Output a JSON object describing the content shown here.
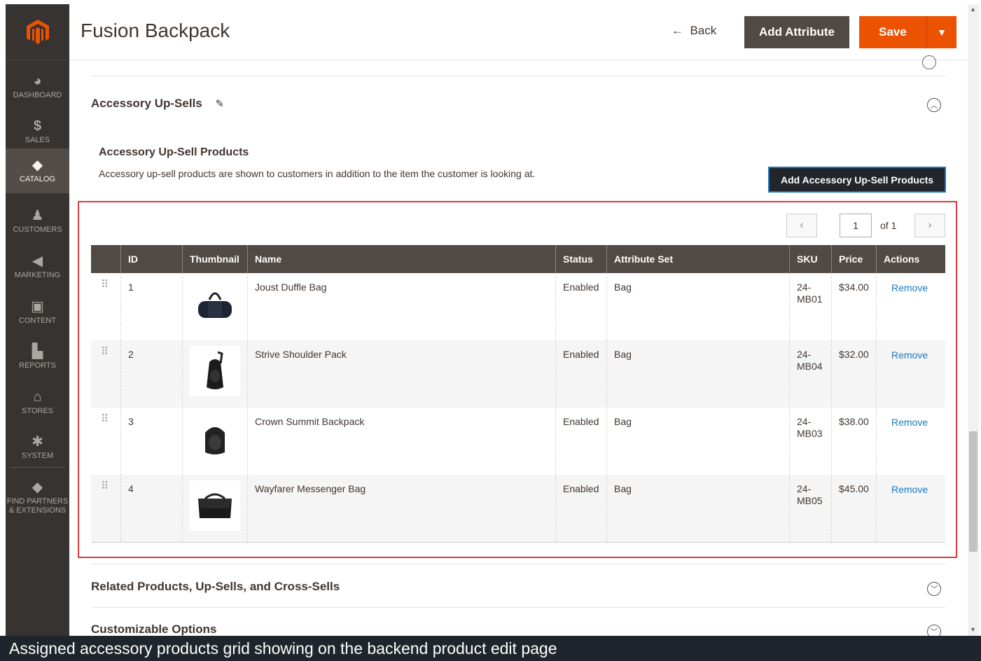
{
  "sidebar": {
    "items": [
      {
        "label": "DASHBOARD",
        "icon": "dashboard-icon"
      },
      {
        "label": "SALES",
        "icon": "dollar-icon"
      },
      {
        "label": "CATALOG",
        "icon": "cube-icon"
      },
      {
        "label": "CUSTOMERS",
        "icon": "person-icon"
      },
      {
        "label": "MARKETING",
        "icon": "megaphone-icon"
      },
      {
        "label": "CONTENT",
        "icon": "layout-icon"
      },
      {
        "label": "REPORTS",
        "icon": "bar-chart-icon"
      },
      {
        "label": "STORES",
        "icon": "store-icon"
      },
      {
        "label": "SYSTEM",
        "icon": "gear-icon"
      },
      {
        "label_line1": "FIND PARTNERS",
        "label_line2": "& EXTENSIONS",
        "icon": "box-icon"
      }
    ],
    "active": "CATALOG"
  },
  "header": {
    "title": "Fusion Backpack",
    "back_label": "Back",
    "add_attribute_label": "Add Attribute",
    "save_label": "Save"
  },
  "sections": {
    "accessory_upsells": {
      "title": "Accessory Up-Sells",
      "sub_title": "Accessory Up-Sell Products",
      "description": "Accessory up-sell products are shown to customers in addition to the item the customer is looking at.",
      "add_button": "Add Accessory Up-Sell Products"
    },
    "related": {
      "title": "Related Products, Up-Sells, and Cross-Sells"
    },
    "customizable": {
      "title": "Customizable Options"
    }
  },
  "pager": {
    "current": "1",
    "of_label": "of 1"
  },
  "grid": {
    "columns": [
      "ID",
      "Thumbnail",
      "Name",
      "Status",
      "Attribute Set",
      "SKU",
      "Price",
      "Actions"
    ],
    "rows": [
      {
        "id": "1",
        "name": "Joust Duffle Bag",
        "status": "Enabled",
        "attribute_set": "Bag",
        "sku_line1": "24-",
        "sku_line2": "MB01",
        "price": "$34.00",
        "action": "Remove",
        "thumb": "duffle-bag"
      },
      {
        "id": "2",
        "name": "Strive Shoulder Pack",
        "status": "Enabled",
        "attribute_set": "Bag",
        "sku_line1": "24-",
        "sku_line2": "MB04",
        "price": "$32.00",
        "action": "Remove",
        "thumb": "shoulder-pack"
      },
      {
        "id": "3",
        "name": "Crown Summit Backpack",
        "status": "Enabled",
        "attribute_set": "Bag",
        "sku_line1": "24-",
        "sku_line2": "MB03",
        "price": "$38.00",
        "action": "Remove",
        "thumb": "backpack"
      },
      {
        "id": "4",
        "name": "Wayfarer Messenger Bag",
        "status": "Enabled",
        "attribute_set": "Bag",
        "sku_line1": "24-",
        "sku_line2": "MB05",
        "price": "$45.00",
        "action": "Remove",
        "thumb": "messenger-bag"
      }
    ]
  },
  "caption": "Assigned accessory products grid showing on the backend product edit page",
  "colors": {
    "sidebar_bg": "#373330",
    "primary_orange": "#eb5202",
    "dark_button": "#514943",
    "link_blue": "#1979c3",
    "highlight_red": "#e0393e"
  }
}
